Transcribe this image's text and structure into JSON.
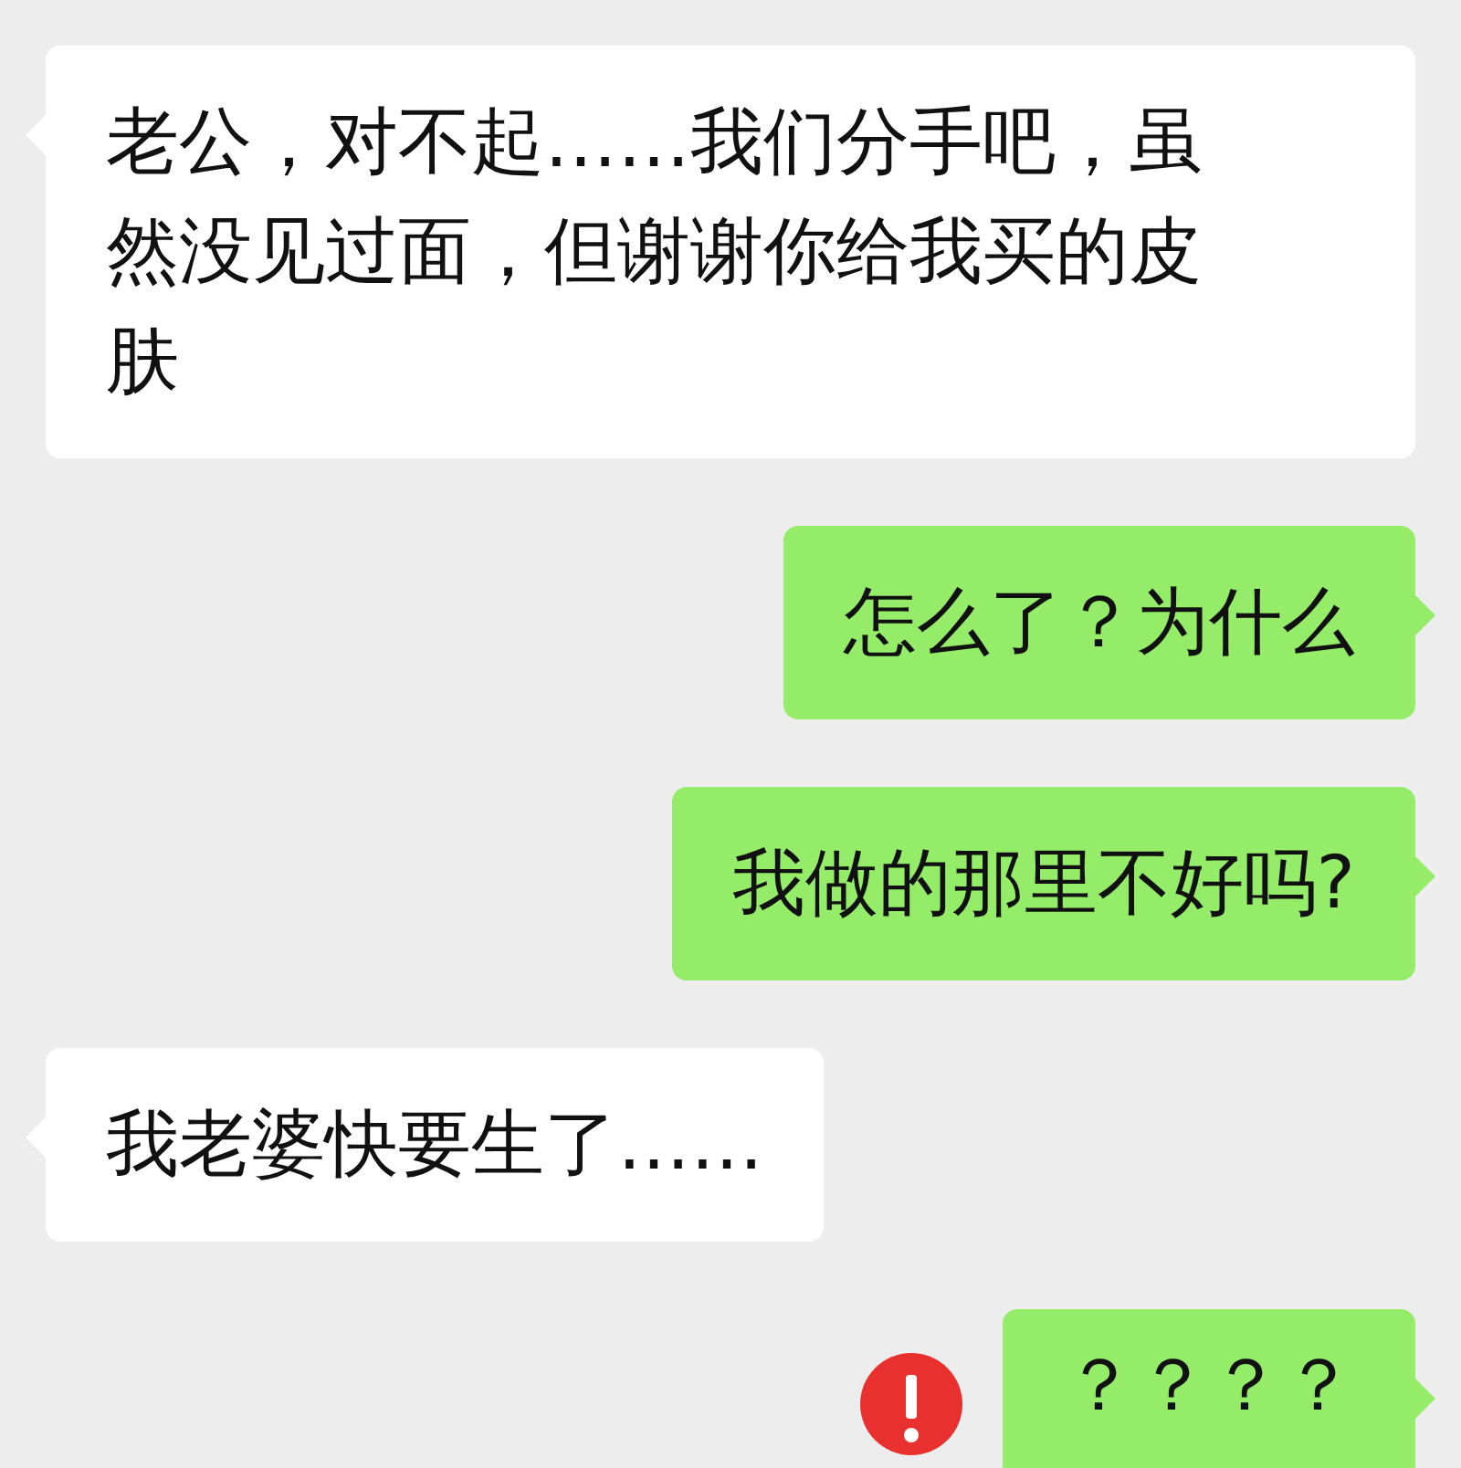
{
  "messages": [
    {
      "kind": "received",
      "text": "老公，对不起……我们分手吧，虽然没见过面，但谢谢你给我买的皮肤",
      "failed": false
    },
    {
      "kind": "sent",
      "text": "怎么了？为什么",
      "failed": false
    },
    {
      "kind": "sent",
      "text": "我做的那里不好吗?",
      "failed": false
    },
    {
      "kind": "received",
      "text": "我老婆快要生了……",
      "failed": false
    },
    {
      "kind": "sent",
      "text": "？？？？",
      "failed": true
    }
  ]
}
